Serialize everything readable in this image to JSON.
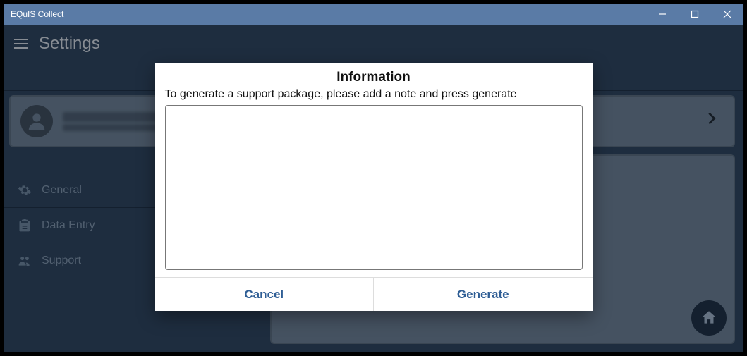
{
  "window": {
    "title": "EQuIS Collect"
  },
  "header": {
    "page_title": "Settings"
  },
  "sidebar": {
    "items": [
      {
        "label": "General",
        "icon": "gear-icon"
      },
      {
        "label": "Data Entry",
        "icon": "clipboard-icon"
      },
      {
        "label": "Support",
        "icon": "people-icon"
      }
    ]
  },
  "dialog": {
    "title": "Information",
    "instruction": "To generate a support package, please add a note and press generate",
    "note_value": "",
    "cancel_label": "Cancel",
    "generate_label": "Generate"
  }
}
